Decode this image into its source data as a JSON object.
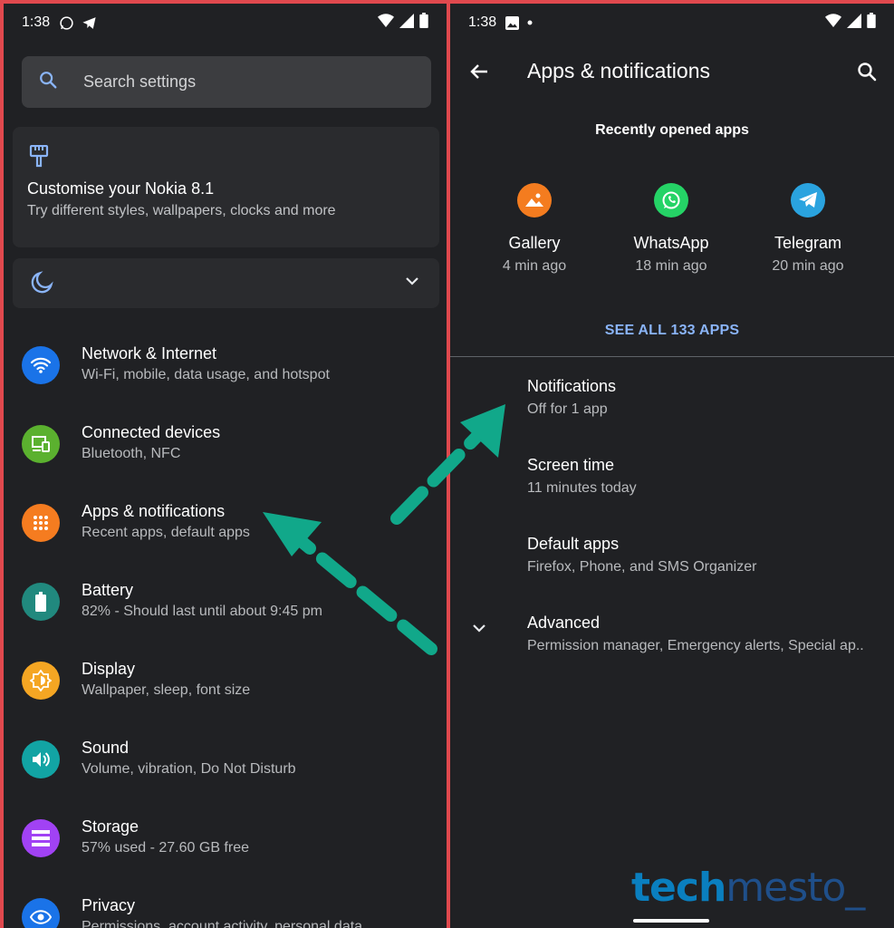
{
  "colors": {
    "background": "#202124",
    "accent_link": "#8ab4f8",
    "frame_border": "#e0494e",
    "arrow": "#11a88a"
  },
  "left_panel": {
    "status": {
      "time": "1:38",
      "icons": [
        "whatsapp-icon",
        "telegram-icon",
        "wifi-icon",
        "signal-icon",
        "battery-icon"
      ]
    },
    "search": {
      "placeholder": "Search settings"
    },
    "customise_card": {
      "title": "Customise your Nokia 8.1",
      "subtitle": "Try different styles, wallpapers, clocks and more"
    },
    "night_card": {
      "icon": "moon-icon"
    },
    "settings": [
      {
        "title": "Network & Internet",
        "subtitle": "Wi-Fi, mobile, data usage, and hotspot",
        "icon": "wifi-icon",
        "color": "#1a73e8"
      },
      {
        "title": "Connected devices",
        "subtitle": "Bluetooth, NFC",
        "icon": "devices-icon",
        "color": "#5bb12f"
      },
      {
        "title": "Apps & notifications",
        "subtitle": "Recent apps, default apps",
        "icon": "apps-grid-icon",
        "color": "#f57c20"
      },
      {
        "title": "Battery",
        "subtitle": "82% - Should last until about 9:45 pm",
        "icon": "battery-icon",
        "color": "#21897e"
      },
      {
        "title": "Display",
        "subtitle": "Wallpaper, sleep, font size",
        "icon": "brightness-icon",
        "color": "#f5a623"
      },
      {
        "title": "Sound",
        "subtitle": "Volume, vibration, Do Not Disturb",
        "icon": "volume-icon",
        "color": "#12a4a4"
      },
      {
        "title": "Storage",
        "subtitle": "57% used - 27.60 GB free",
        "icon": "storage-icon",
        "color": "#a142f4"
      },
      {
        "title": "Privacy",
        "subtitle": "Permissions, account activity, personal data",
        "icon": "eye-icon",
        "color": "#1a73e8"
      }
    ]
  },
  "right_panel": {
    "status": {
      "time": "1:38",
      "icons": [
        "image-icon",
        "dot-icon",
        "wifi-icon",
        "signal-icon",
        "battery-icon"
      ]
    },
    "header": {
      "title": "Apps & notifications"
    },
    "recent": {
      "title": "Recently opened apps",
      "apps": [
        {
          "name": "Gallery",
          "time": "4 min ago",
          "icon": "gallery-icon",
          "color": "#f47c1f"
        },
        {
          "name": "WhatsApp",
          "time": "18 min ago",
          "icon": "whatsapp-icon",
          "color": "#25d366"
        },
        {
          "name": "Telegram",
          "time": "20 min ago",
          "icon": "telegram-icon",
          "color": "#2aa3df"
        }
      ],
      "see_all": "SEE ALL 133 APPS"
    },
    "items": [
      {
        "title": "Notifications",
        "subtitle": "Off for 1 app"
      },
      {
        "title": "Screen time",
        "subtitle": "11 minutes today"
      },
      {
        "title": "Default apps",
        "subtitle": "Firefox, Phone, and SMS Organizer"
      },
      {
        "title": "Advanced",
        "subtitle": "Permission manager, Emergency alerts, Special ap.."
      }
    ],
    "watermark": {
      "part1": "tech",
      "part2": "mesto_"
    }
  }
}
